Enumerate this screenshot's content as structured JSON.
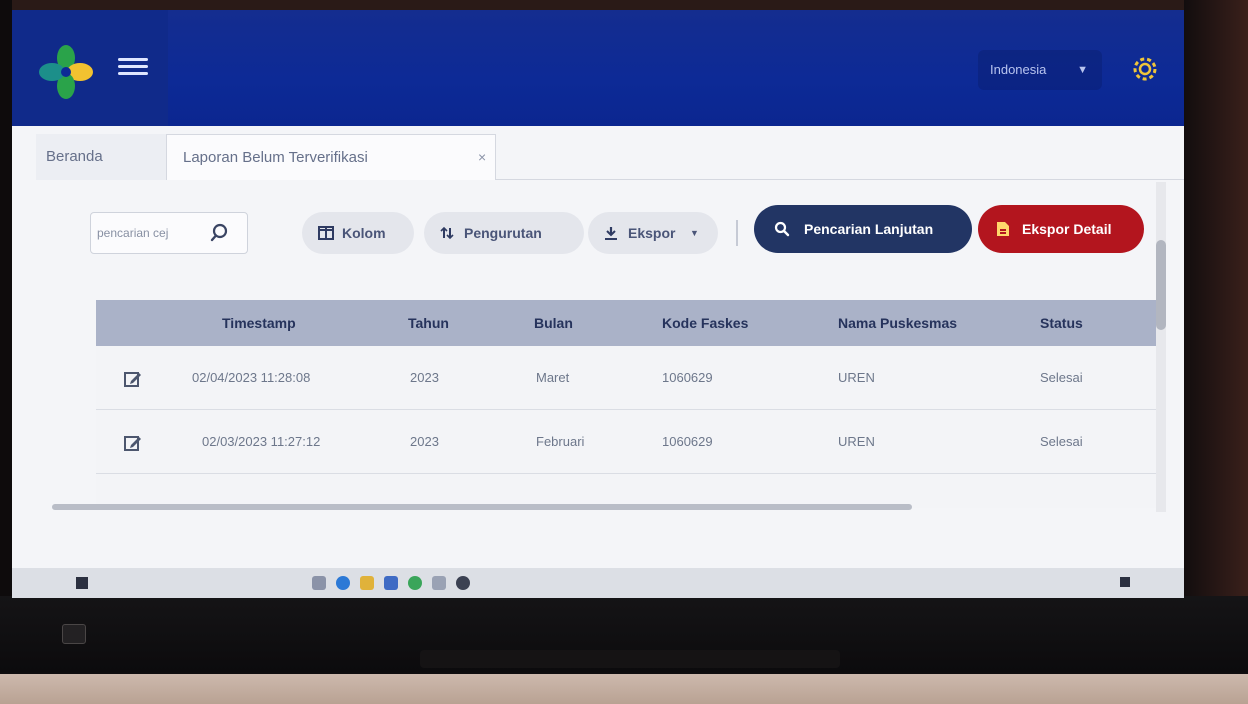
{
  "header": {
    "language": "Indonesia"
  },
  "tabs": [
    {
      "label": "Beranda",
      "active": false
    },
    {
      "label": "Laporan Belum Terverifikasi",
      "active": true
    }
  ],
  "toolbar": {
    "search_placeholder": "pencarian cej",
    "kolom": "Kolom",
    "pengurutan": "Pengurutan",
    "ekspor": "Ekspor",
    "pencarian_lanjutan": "Pencarian Lanjutan",
    "ekspor_detail": "Ekspor Detail"
  },
  "table": {
    "headers": [
      "Timestamp",
      "Tahun",
      "Bulan",
      "Kode Faskes",
      "Nama Puskesmas",
      "Status"
    ],
    "rows": [
      {
        "timestamp": "02/04/2023 11:28:08",
        "tahun": "2023",
        "bulan": "Maret",
        "kode": "1060629",
        "nama": "UREN",
        "status": "Selesai"
      },
      {
        "timestamp": "02/03/2023 11:27:12",
        "tahun": "2023",
        "bulan": "Februari",
        "kode": "1060629",
        "nama": "UREN",
        "status": "Selesai"
      }
    ]
  },
  "colors": {
    "header_blue": "#0d2a96",
    "primary_navy": "#223564",
    "danger_red": "#b3151e"
  },
  "icons": [
    "logo-icon",
    "menu-icon",
    "settings-icon",
    "search-icon",
    "columns-icon",
    "sort-icon",
    "download-icon",
    "file-icon",
    "edit-icon"
  ]
}
